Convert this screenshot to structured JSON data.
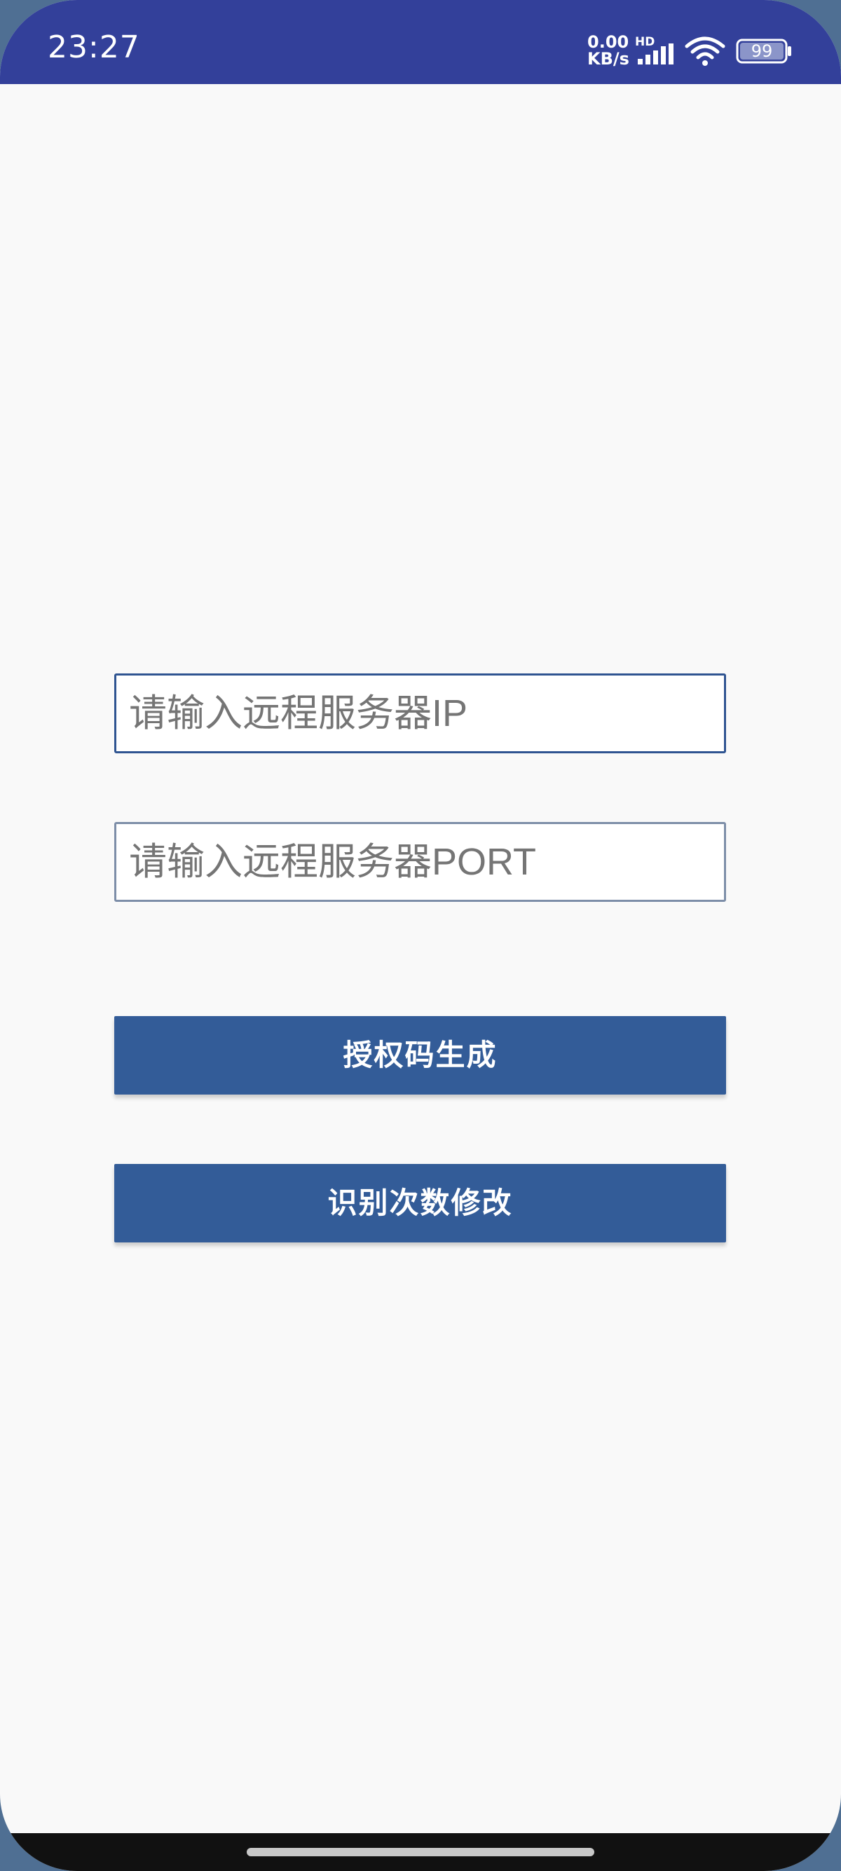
{
  "status_bar": {
    "time": "23:27",
    "net_speed_value": "0.00",
    "net_speed_unit": "KB/s",
    "hd_label": "HD",
    "battery_level": "99",
    "signal_icon": "signal-icon",
    "wifi_icon": "wifi-icon",
    "battery_icon": "battery-icon",
    "background_color": "#33409a"
  },
  "form": {
    "ip_placeholder": "请输入远程服务器IP",
    "ip_value": "",
    "port_placeholder": "请输入远程服务器PORT",
    "port_value": ""
  },
  "buttons": {
    "auth_label": "授权码生成",
    "count_label": "识别次数修改",
    "color": "#335c98"
  }
}
